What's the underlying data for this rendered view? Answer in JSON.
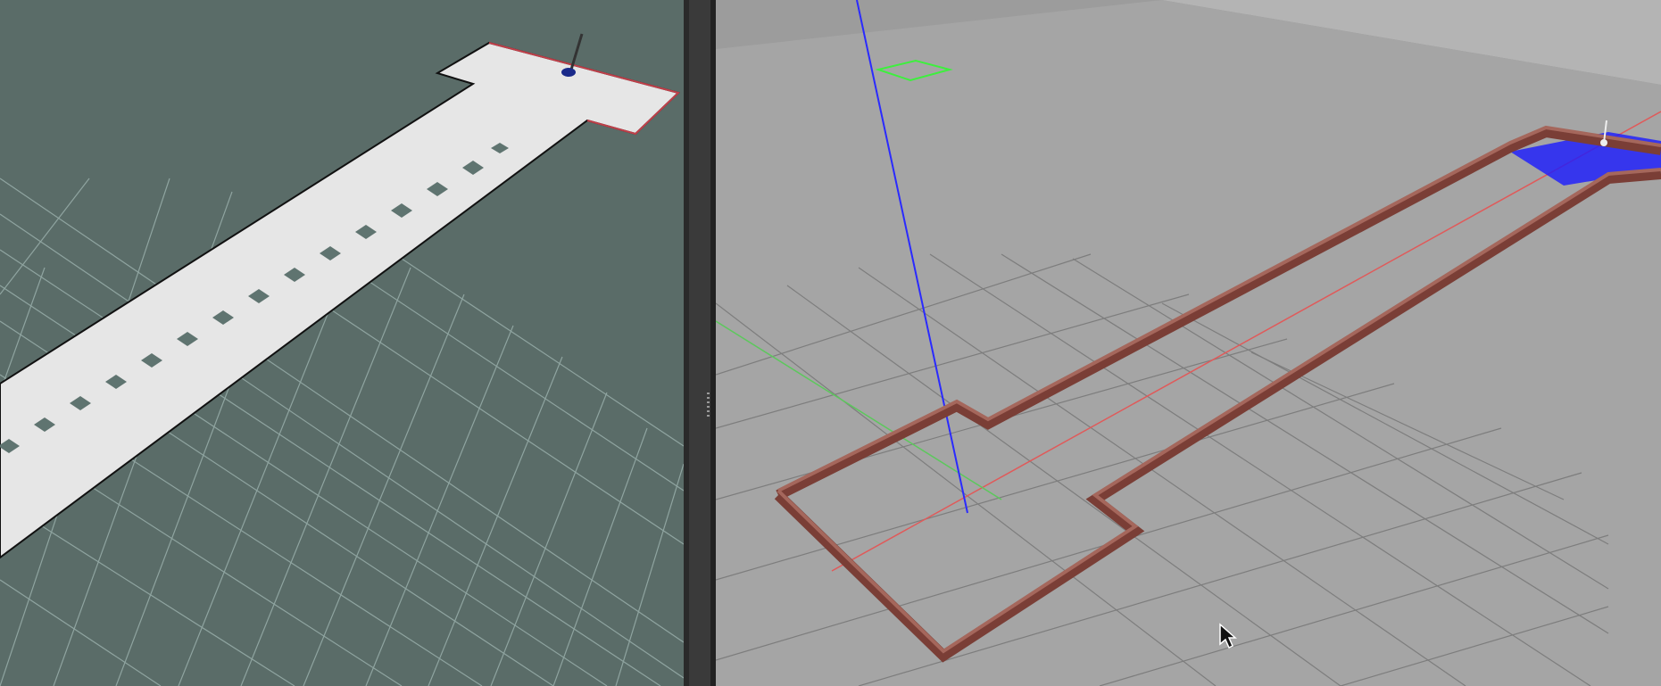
{
  "rviz": {
    "colors": {
      "background": "#5a6c68",
      "grid": "#8fa4a0",
      "free_space": "#e6e6e6",
      "path": "#5f7470",
      "robot": "#1a2a8a"
    }
  },
  "gazebo": {
    "colors": {
      "background": "#9c9c9c",
      "floor": "#a5a5a5",
      "grid": "#7d7d7d",
      "wall": "#7a3e36",
      "wall_top": "#a5675c",
      "laser": "#1a1aff",
      "z_axis": "#2a2aff",
      "x_axis": "#e05a5a",
      "y_axis": "#5cc85c"
    },
    "cursor_icon": "mouse-pointer-icon"
  }
}
